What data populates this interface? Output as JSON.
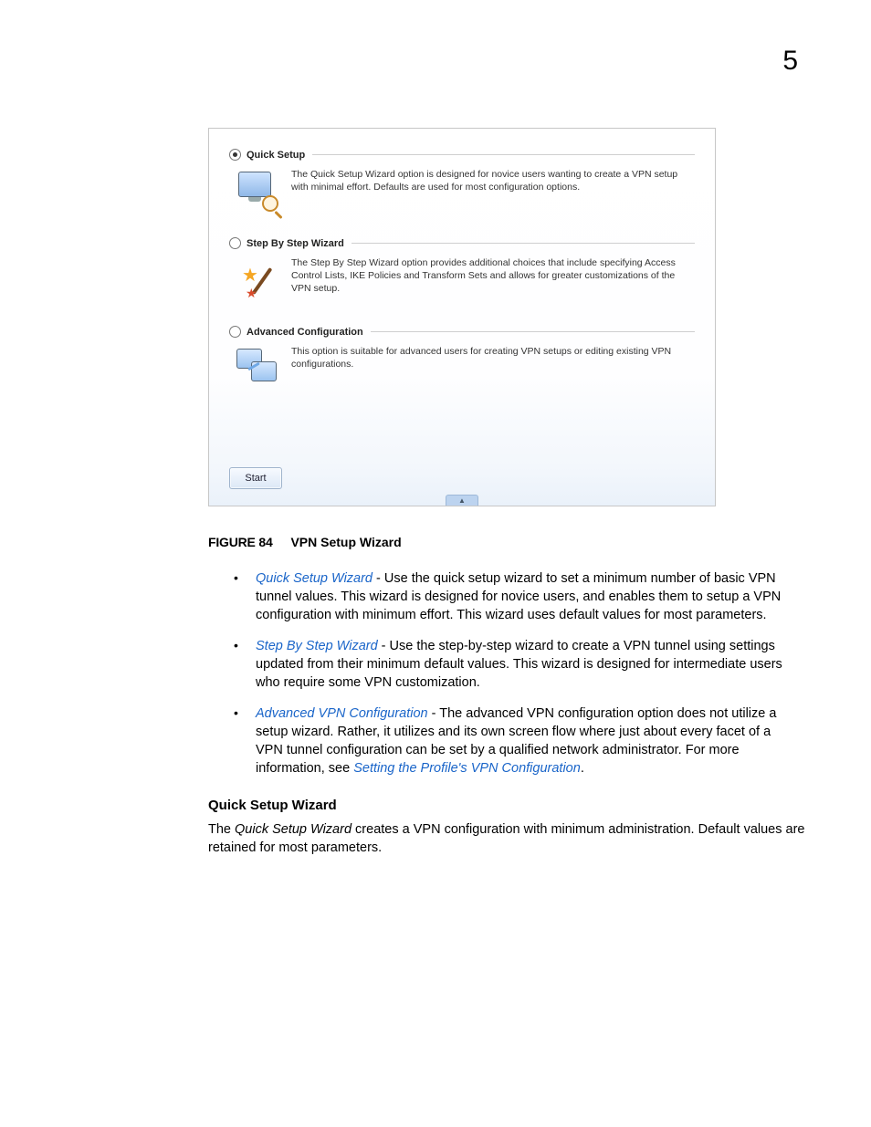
{
  "pageNumber": "5",
  "wizard": {
    "options": [
      {
        "id": "quick",
        "checked": true,
        "label": "Quick Setup",
        "description": "The Quick Setup Wizard option is designed for novice users wanting to create a VPN setup with minimal effort. Defaults are used for most configuration options."
      },
      {
        "id": "step",
        "checked": false,
        "label": "Step By Step Wizard",
        "description": "The Step By Step Wizard option provides additional choices that include specifying Access Control Lists, IKE Policies and Transform Sets and allows for greater customizations of the VPN setup."
      },
      {
        "id": "advanced",
        "checked": false,
        "label": "Advanced Configuration",
        "description": "This option is suitable for advanced users for creating VPN setups or editing existing VPN configurations."
      }
    ],
    "startButton": "Start",
    "collapseGlyph": "▲"
  },
  "figure": {
    "number": "FIGURE 84",
    "title": "VPN Setup Wizard"
  },
  "bullets": [
    {
      "link": "Quick Setup Wizard",
      "text": " - Use the quick setup wizard to set a minimum number of basic VPN tunnel values. This wizard is designed for novice users, and enables them to setup a VPN configuration with minimum effort. This wizard uses default values for most parameters."
    },
    {
      "link": "Step By Step Wizard",
      "text": " - Use the step-by-step wizard to create a VPN tunnel using settings updated from their minimum default values. This wizard is designed for intermediate users who require some VPN customization."
    },
    {
      "link": "Advanced VPN Configuration",
      "text": " - The advanced VPN configuration option does not utilize a setup wizard. Rather, it utilizes and its own screen flow where just about every facet of a VPN tunnel configuration can be set by a qualified network administrator. For more information, see ",
      "trailingLink": "Setting the Profile's VPN Configuration",
      "trailingText": "."
    }
  ],
  "section": {
    "heading": "Quick Setup Wizard",
    "para_pre": "The ",
    "para_em": "Quick Setup Wizard",
    "para_post": " creates a VPN configuration with minimum administration. Default values are retained for most parameters."
  }
}
